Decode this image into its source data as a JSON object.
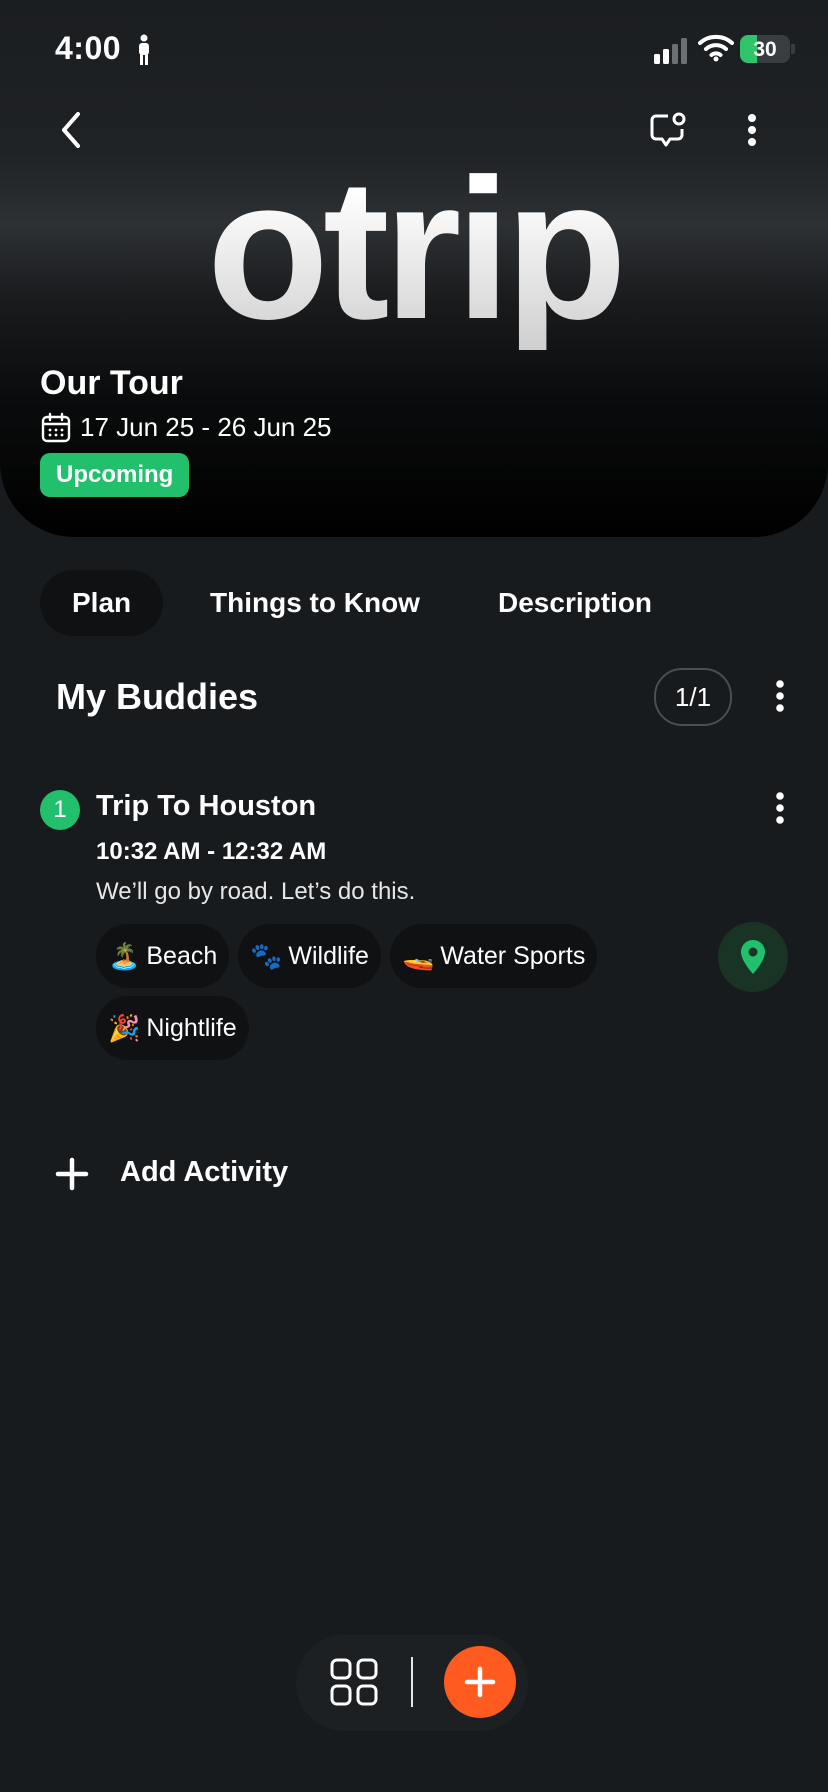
{
  "status_bar": {
    "time": "4:00",
    "battery": "30"
  },
  "header": {
    "logo": "otrip",
    "title": "Our Tour",
    "dates": "17 Jun 25 - 26 Jun 25",
    "status": "Upcoming"
  },
  "tabs": [
    {
      "label": "Plan",
      "active": true
    },
    {
      "label": "Things to Know",
      "active": false
    },
    {
      "label": "Description",
      "active": false
    }
  ],
  "buddies": {
    "title": "My Buddies",
    "counter": "1/1"
  },
  "activity": {
    "number": "1",
    "title": "Trip To Houston",
    "time": "10:32 AM - 12:32 AM",
    "description": "We’ll go by road. Let’s do this.",
    "tags": [
      {
        "emoji": "🏝️",
        "label": "Beach"
      },
      {
        "emoji": "🐾",
        "label": "Wildlife"
      },
      {
        "emoji": "🚤",
        "label": "Water Sports"
      },
      {
        "emoji": "🎉",
        "label": "Nightlife"
      }
    ]
  },
  "add_activity": {
    "label": "Add Activity"
  },
  "colors": {
    "accent_green": "#22c06d",
    "fab_orange": "#ff5a1f",
    "background": "#181b1e"
  },
  "icons": [
    "person-icon",
    "signal-icon",
    "wifi-icon",
    "back-icon",
    "chat-icon",
    "more-icon",
    "calendar-icon",
    "map-pin-icon",
    "plus-icon",
    "grid-icon"
  ]
}
